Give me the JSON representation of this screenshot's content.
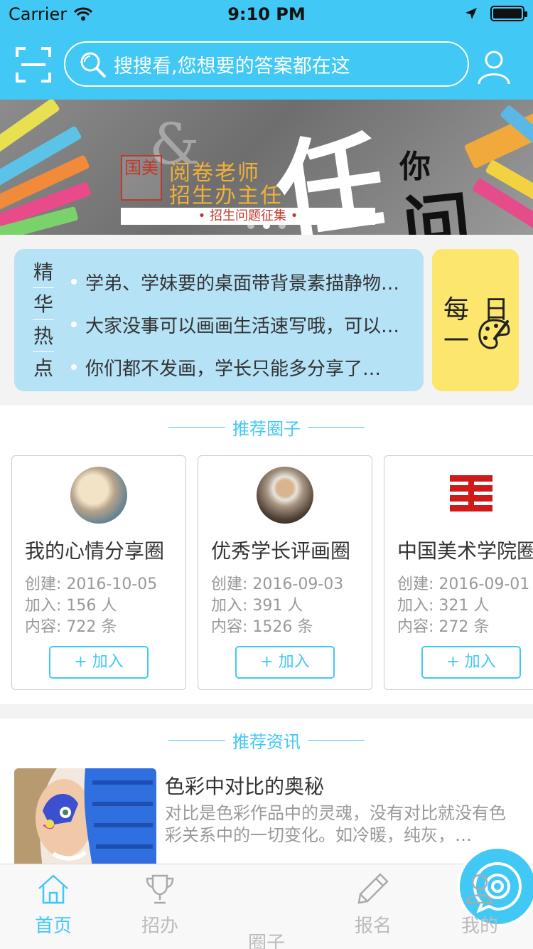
{
  "status_bar": {
    "carrier": "Carrier",
    "time": "9:10 PM"
  },
  "header": {
    "search_placeholder": "搜搜看,您想要的答案都在这",
    "accent_color": "#42c8f4"
  },
  "banner": {
    "amp": "&",
    "seal": "国美",
    "line1": "阅卷老师",
    "line2": "招生办主任",
    "strip": "•   招生问题征集   •",
    "calli_big": "任",
    "calli_ni": "你",
    "calli_wen": "问",
    "dots_active": 0
  },
  "hot": {
    "title_chars": [
      "精",
      "华",
      "热",
      "点"
    ],
    "items": [
      "学弟、学妹要的桌面带背景素描静物…",
      "大家没事可以画画生活速写哦，可以…",
      "你们都不发画，学长只能多分享了…"
    ],
    "daily_chars": [
      "每",
      "日",
      "一"
    ]
  },
  "circles": {
    "section_title": "推荐圈子",
    "join_label": "+ 加入",
    "items": [
      {
        "name": "我的心情分享圈",
        "created": "创建: 2016-10-05",
        "members": "加入: 156 人",
        "posts": "内容: 722 条"
      },
      {
        "name": "优秀学长评画圈",
        "created": "创建: 2016-09-03",
        "members": "加入: 391 人",
        "posts": "内容: 1526 条"
      },
      {
        "name": "中国美术学院圈",
        "created": "创建: 2016-09-01",
        "members": "加入: 321 人",
        "posts": "内容: 272 条"
      }
    ]
  },
  "news": {
    "section_title": "推荐资讯",
    "items": [
      {
        "title": "色彩中对比的奥秘",
        "desc": "对比是色彩作品中的灵魂，没有对比就没有色彩关系中的一切变化。如冷暖，纯灰，…"
      }
    ]
  },
  "tabbar": {
    "items": [
      {
        "label": "首页",
        "icon": "home-icon",
        "active": true
      },
      {
        "label": "招办",
        "icon": "trophy-icon",
        "active": false
      },
      {
        "label": "圈子",
        "icon": "chat-bubble-icon",
        "active": false
      },
      {
        "label": "报名",
        "icon": "pencil-icon",
        "active": false
      },
      {
        "label": "我的",
        "icon": "user-icon",
        "active": false
      }
    ]
  }
}
